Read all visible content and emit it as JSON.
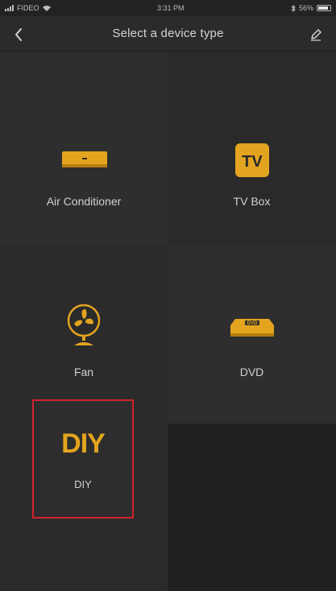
{
  "status_bar": {
    "carrier": "FIDEO",
    "time": "3:31 PM",
    "battery_pct": "56%"
  },
  "nav": {
    "title": "Select a device type"
  },
  "devices": [
    {
      "label": "Air Conditioner",
      "icon": "air-conditioner-icon"
    },
    {
      "label": "TV Box",
      "icon": "tv-box-icon",
      "icon_text": "TV"
    },
    {
      "label": "Fan",
      "icon": "fan-icon"
    },
    {
      "label": "DVD",
      "icon": "dvd-icon",
      "icon_text": "DVD"
    },
    {
      "label": "DIY",
      "icon": "diy-icon",
      "icon_text": "DIY"
    }
  ],
  "colors": {
    "accent": "#e3a41f",
    "highlight_border": "#d2232f",
    "background": "#1c1c1c"
  }
}
